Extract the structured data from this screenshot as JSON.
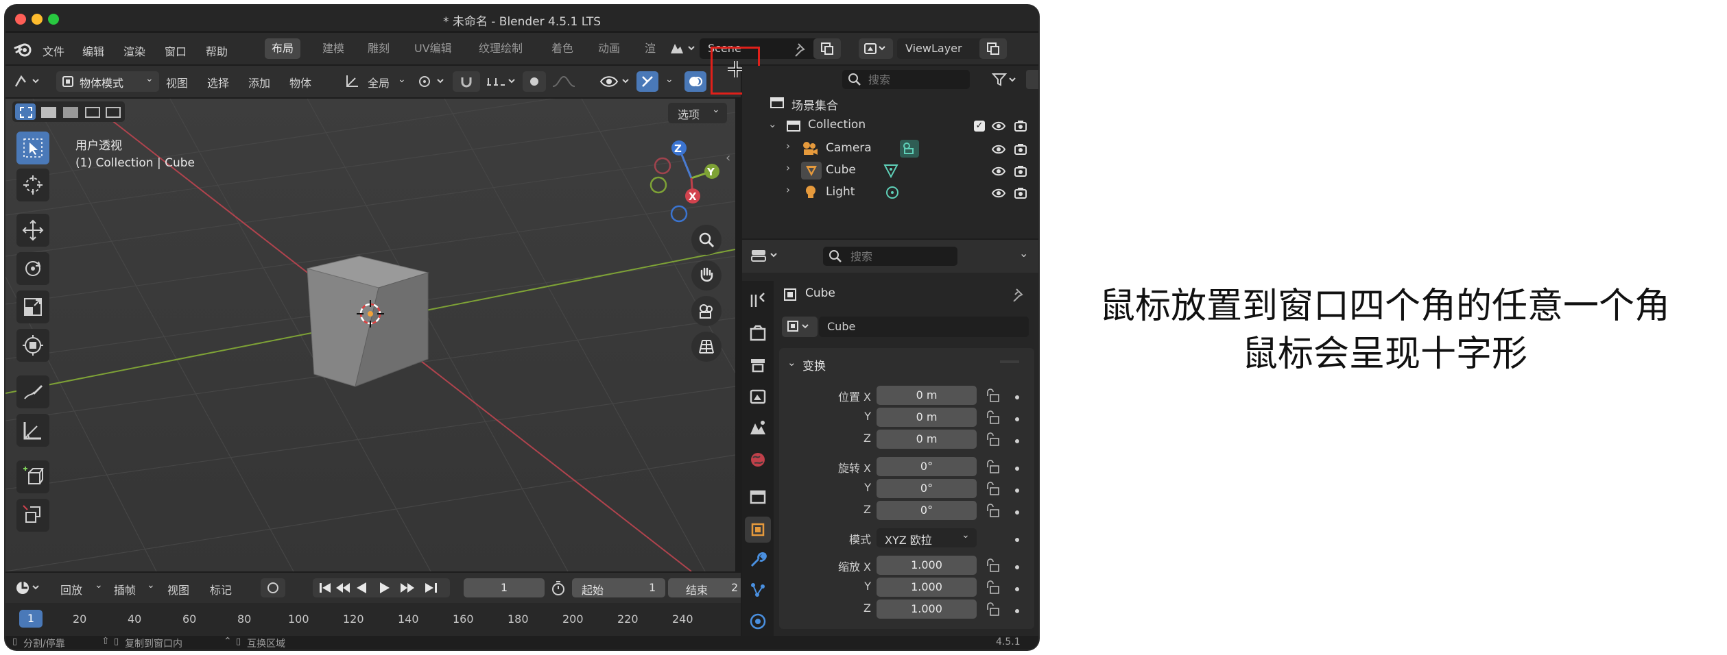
{
  "window": {
    "title": "* 未命名 - Blender 4.5.1 LTS",
    "traffic_lights": [
      "#ff5f57",
      "#febc2e",
      "#28c840"
    ]
  },
  "menubar": {
    "items": [
      "文件",
      "编辑",
      "渲染",
      "窗口",
      "帮助"
    ],
    "workspaces": [
      "布局",
      "建模",
      "雕刻",
      "UV编辑",
      "纹理绘制",
      "着色",
      "动画",
      "渲"
    ],
    "active_workspace": "布局",
    "scene_label": "Scene",
    "viewlayer_label": "ViewLayer"
  },
  "viewport_header": {
    "mode": "物体模式",
    "menus": [
      "视图",
      "选择",
      "添加",
      "物体"
    ],
    "transform_orientation": "全局",
    "options_label": "选项"
  },
  "viewport": {
    "view_name": "用户透视",
    "collection_info": "(1) Collection | Cube",
    "gizmo_axes": [
      "Z",
      "Y",
      "X"
    ],
    "grid_color": "#464646",
    "axis_x_color": "#b0434d",
    "axis_y_color": "#7ea236"
  },
  "outliner": {
    "search_placeholder": "搜索",
    "root": "场景集合",
    "collection": "Collection",
    "objects": [
      "Camera",
      "Cube",
      "Light"
    ]
  },
  "properties": {
    "search_placeholder": "搜索",
    "object_name": "Cube",
    "object_datablock": "Cube",
    "section": "变换",
    "location": {
      "label": "位置 X",
      "values": [
        "0 m",
        "0 m",
        "0 m"
      ]
    },
    "rotation": {
      "label": "旋转 X",
      "values": [
        "0°",
        "0°",
        "0°"
      ]
    },
    "mode": {
      "label": "模式",
      "value": "XYZ 欧拉"
    },
    "scale": {
      "label": "缩放 X",
      "values": [
        "1.000",
        "1.000",
        "1.000"
      ]
    },
    "axis_y": "Y",
    "axis_z": "Z"
  },
  "timeline": {
    "menus": [
      "回放",
      "插帧",
      "视图",
      "标记"
    ],
    "current_frame": "1",
    "start_label": "起始",
    "start_value": "1",
    "end_label": "结束",
    "end_value": "2",
    "ruler": [
      "1",
      "20",
      "40",
      "60",
      "80",
      "100",
      "120",
      "140",
      "160",
      "180",
      "200",
      "220",
      "240"
    ]
  },
  "statusbar": {
    "hints": [
      "分割/停靠",
      "复制到窗口内",
      "互换区域"
    ],
    "version": "4.5.1"
  },
  "annotation": {
    "line1": "鼠标放置到窗口四个角的任意一个角",
    "line2": "鼠标会呈现十字形",
    "highlight_color": "#e0201a"
  }
}
